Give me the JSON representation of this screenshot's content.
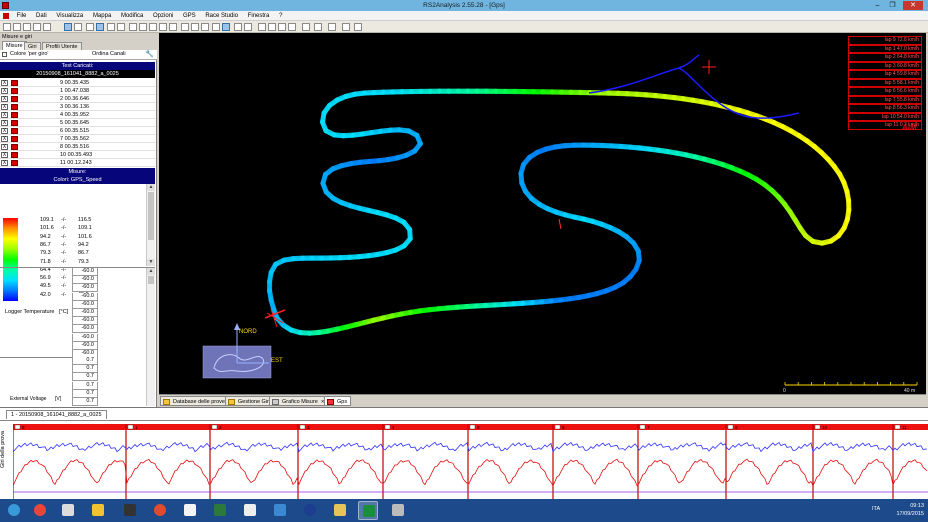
{
  "window": {
    "title": "RS2Analysis 2.55.28 - [Gps]"
  },
  "menu": [
    "File",
    "Dati",
    "Visualizza",
    "Mappa",
    "Modifica",
    "Opzioni",
    "GPS",
    "Race Studio",
    "Finestra",
    "?"
  ],
  "left_panel": {
    "title": "Misure e giri",
    "tabs": [
      "Misure",
      "Giri",
      "Profili Utente"
    ],
    "color_per_lap": "Colore 'per giro'",
    "sort_channels": "Ordina Canali",
    "tests_header": "Test Caricati:",
    "test_name": "20150908_161041_8882_a_0025",
    "laps": [
      {
        "n": "9",
        "time": "00.35.435"
      },
      {
        "n": "1",
        "time": "00.47.038"
      },
      {
        "n": "2",
        "time": "00.36.646"
      },
      {
        "n": "3",
        "time": "00.36.136"
      },
      {
        "n": "4",
        "time": "00.35.952"
      },
      {
        "n": "5",
        "time": "00.35.645"
      },
      {
        "n": "6",
        "time": "00.35.515"
      },
      {
        "n": "7",
        "time": "00.35.562"
      },
      {
        "n": "8",
        "time": "00.35.516"
      },
      {
        "n": "10",
        "time": "00.35.493"
      },
      {
        "n": "11",
        "time": "00.12.243"
      }
    ],
    "measures_header": "Misure:",
    "colors_label": "Colori: GPS_Speed",
    "color_scale": [
      [
        "109.1",
        "116.5"
      ],
      [
        "101.6",
        "109.1"
      ],
      [
        "94.2",
        "101.6"
      ],
      [
        "86.7",
        "94.2"
      ],
      [
        "79.3",
        "86.7"
      ],
      [
        "71.8",
        "79.3"
      ],
      [
        "64.4",
        "71.8"
      ],
      [
        "56.9",
        "64.4"
      ],
      [
        "49.5",
        "56.9"
      ],
      [
        "42.0",
        "49.5"
      ]
    ],
    "scale_sep": "-/-",
    "logger_temperature_label": "Logger Temperature",
    "logger_temperature_unit": "[°C]",
    "temp_values": [
      "-60.0",
      "-60.0",
      "-60.0",
      "-60.0",
      "-60.0",
      "-60.0",
      "-60.0",
      "-60.0",
      "-60.0",
      "-60.0",
      "-60.0"
    ],
    "extra_values": [
      "0.7",
      "0.7",
      "0.7",
      "0.7",
      "0.7",
      "0.7"
    ],
    "external_voltage_label": "External Voltage",
    "external_voltage_unit": "[V]"
  },
  "map": {
    "north_label": "NORD",
    "east_label": "EST",
    "scale_start": "0",
    "scale_end": "40 m",
    "logo": "AIM",
    "lap_legend": [
      "lap 9 72.8 km/h",
      "lap 1 47.0 km/h",
      "lap 2 64.8 km/h",
      "lap 3 60.8 km/h",
      "lap 4 59.8 km/h",
      "lap 5 58.1 km/h",
      "lap 6 56.6 km/h",
      "lap 7 55.8 km/h",
      "lap 8 56.3 km/h",
      "lap 10 54.0 km/h",
      "lap 11 0.3 km/h"
    ],
    "speed_colors": [
      "#0000ff",
      "#0080ff",
      "#00e0ff",
      "#00ffa0",
      "#00ff00",
      "#a0ff00",
      "#ffff00",
      "#ff8c00",
      "#ff0000"
    ]
  },
  "bottom_tabs": [
    "Database delle prove",
    "Gestione Giri",
    "Grafico Misure",
    "Gps"
  ],
  "graph": {
    "tab_label": "1 - 20150908_161041_8882_a_0025",
    "y_label": "Giri della prova",
    "lap_markers": [
      "9",
      "1",
      "2",
      "3",
      "4",
      "5",
      "6",
      "7",
      "8",
      "10",
      "11"
    ]
  },
  "taskbar": {
    "lang": "ITA",
    "time": "09:13",
    "date": "17/09/2015"
  }
}
